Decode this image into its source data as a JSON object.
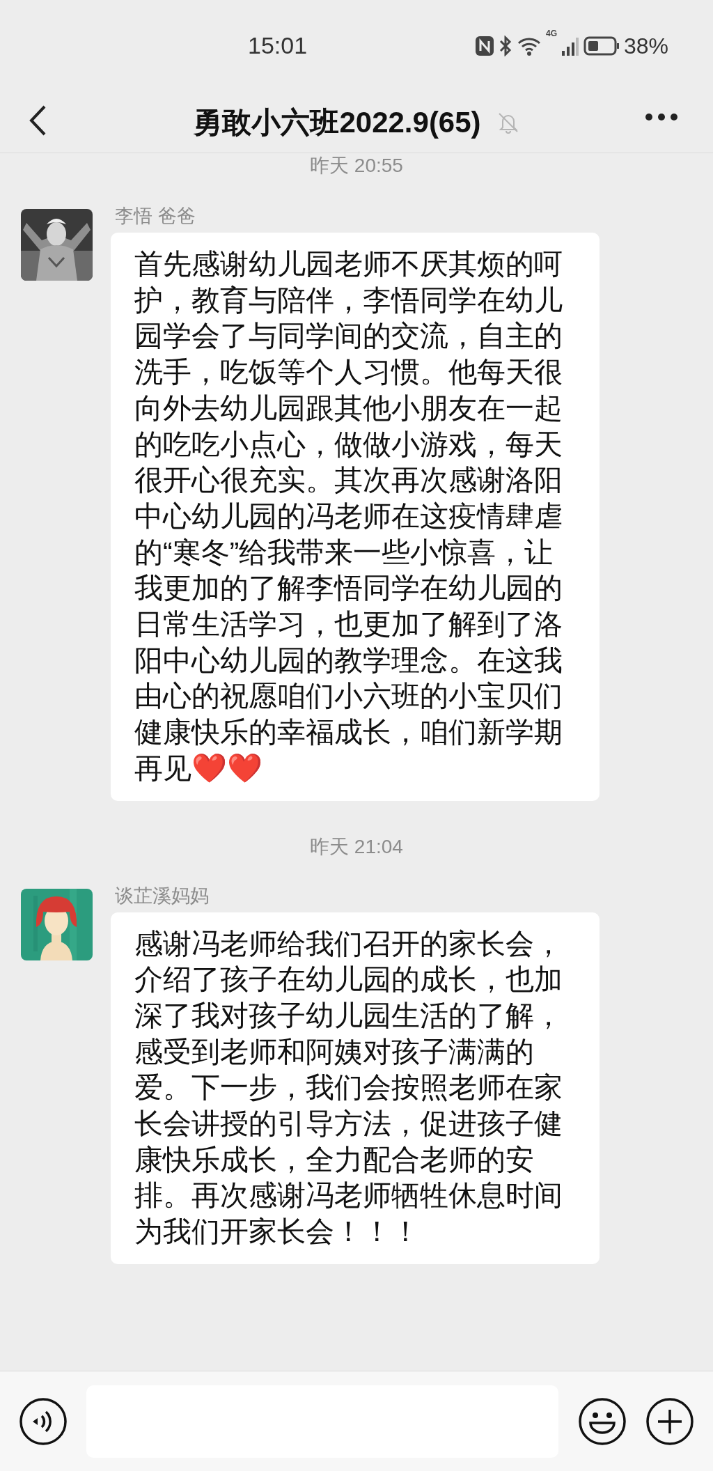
{
  "status_bar": {
    "time": "15:01",
    "network": "4G",
    "battery": "38%"
  },
  "header": {
    "title": "勇敢小六班2022.9(65)",
    "muted": true
  },
  "messages": [
    {
      "timestamp": "昨天 20:55",
      "sender": "李悟 爸爸",
      "text": "首先感谢幼儿园老师不厌其烦的呵护，教育与陪伴，李悟同学在幼儿园学会了与同学间的交流，自主的洗手，吃饭等个人习惯。他每天很向外去幼儿园跟其他小朋友在一起的吃吃小点心，做做小游戏，每天很开心很充实。其次再次感谢洛阳中心幼儿园的冯老师在这疫情肆虐的“寒冬”给我带来一些小惊喜，让我更加的了解李悟同学在幼儿园的日常生活学习，也更加了解到了洛阳中心幼儿园的教学理念。在这我由心的祝愿咱们小六班的小宝贝们健康快乐的幸福成长，咱们新学期再见❤️❤️"
    },
    {
      "timestamp": "昨天 21:04",
      "sender": "谈芷溪妈妈",
      "text": "感谢冯老师给我们召开的家长会，介绍了孩子在幼儿园的成长，也加深了我对孩子幼儿园生活的了解，感受到老师和阿姨对孩子满满的爱。下一步，我们会按照老师在家长会讲授的引导方法，促进孩子健康快乐成长，全力配合老师的安排。再次感谢冯老师牺牲休息时间为我们开家长会！！！"
    }
  ]
}
